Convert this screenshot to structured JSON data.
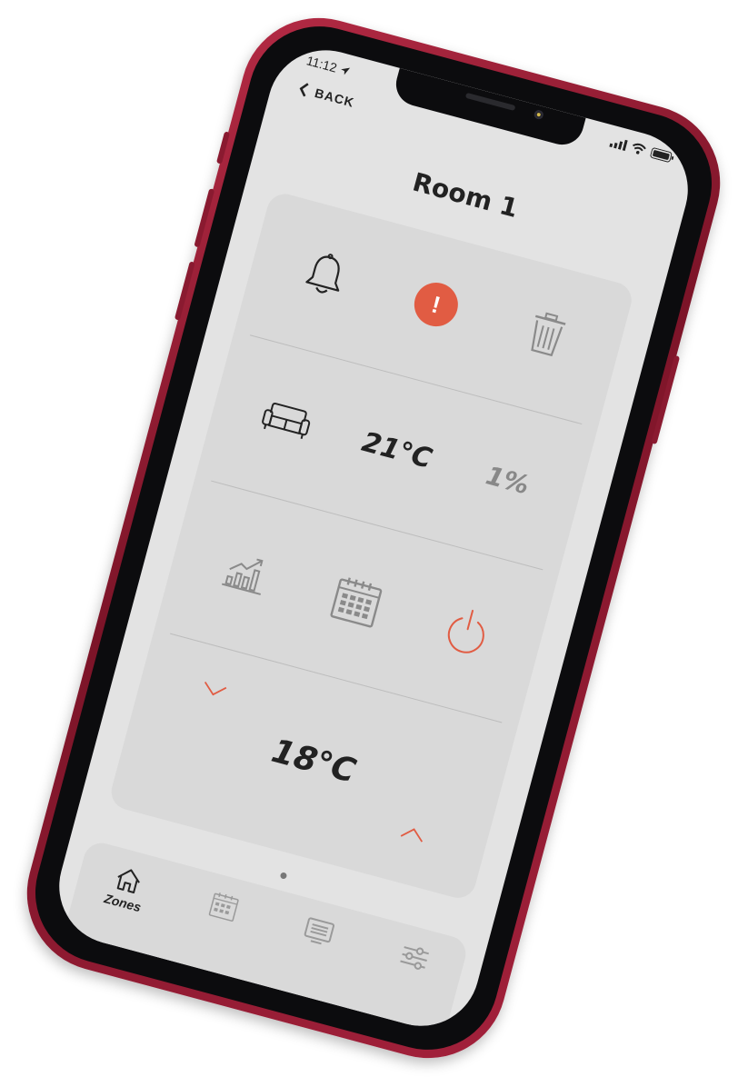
{
  "status": {
    "time": "11:12"
  },
  "header": {
    "back_label": "BACK",
    "title": "Room 1"
  },
  "colors": {
    "accent": "#e15c43",
    "frame": "#9b1e36",
    "screen": "#e3e3e3",
    "card": "#d9d9d9"
  },
  "panel": {
    "row1": {
      "icons": [
        "bell-icon",
        "alert-icon",
        "trash-icon"
      ],
      "alert_symbol": "!"
    },
    "row2": {
      "icon": "sofa-icon",
      "temperature": "21℃",
      "percentage": "1%"
    },
    "row3": {
      "icons": [
        "chart-icon",
        "calendar-icon",
        "power-icon"
      ]
    },
    "row4": {
      "setpoint": "18℃",
      "decrease_icon": "chevron-down-icon",
      "increase_icon": "chevron-up-icon"
    }
  },
  "tabbar": {
    "items": [
      {
        "label": "Zones",
        "icon": "home-icon",
        "active": true
      },
      {
        "label": "",
        "icon": "calendar-icon",
        "active": false
      },
      {
        "label": "",
        "icon": "list-icon",
        "active": false
      },
      {
        "label": "",
        "icon": "sliders-icon",
        "active": false
      }
    ]
  }
}
